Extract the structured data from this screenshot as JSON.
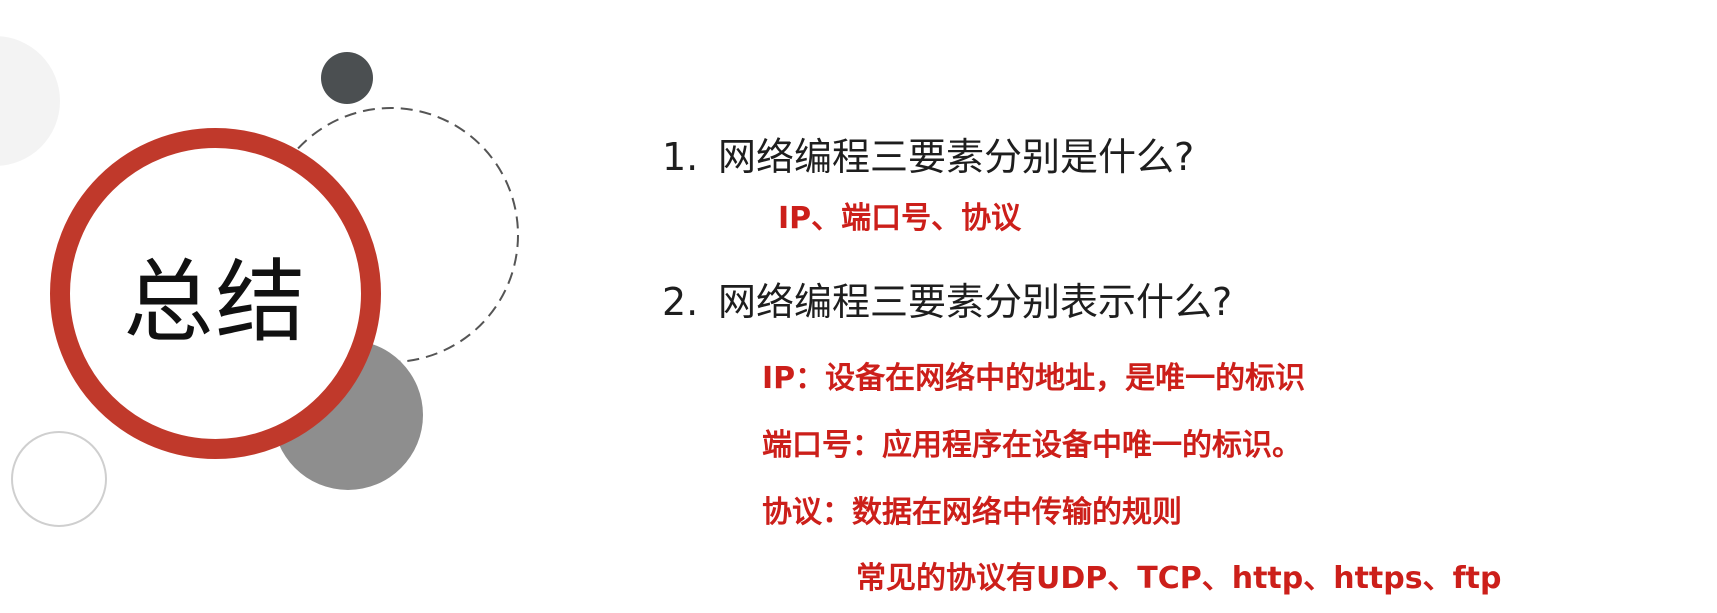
{
  "title": "总结",
  "questions": [
    {
      "number": "1.",
      "text": "网络编程三要素分别是什么?",
      "answers": [
        "IP、端口号、协议"
      ]
    },
    {
      "number": "2.",
      "text": "网络编程三要素分别表示什么?",
      "answers": [
        "IP：设备在网络中的地址，是唯一的标识",
        "端口号：应用程序在设备中唯一的标识。",
        "协议：数据在网络中传输的规则",
        "常见的协议有UDP、TCP、http、https、ftp"
      ]
    }
  ],
  "colors": {
    "accent": "#c0392b",
    "answer": "#cc1f1a",
    "question": "#1e1e1e"
  }
}
